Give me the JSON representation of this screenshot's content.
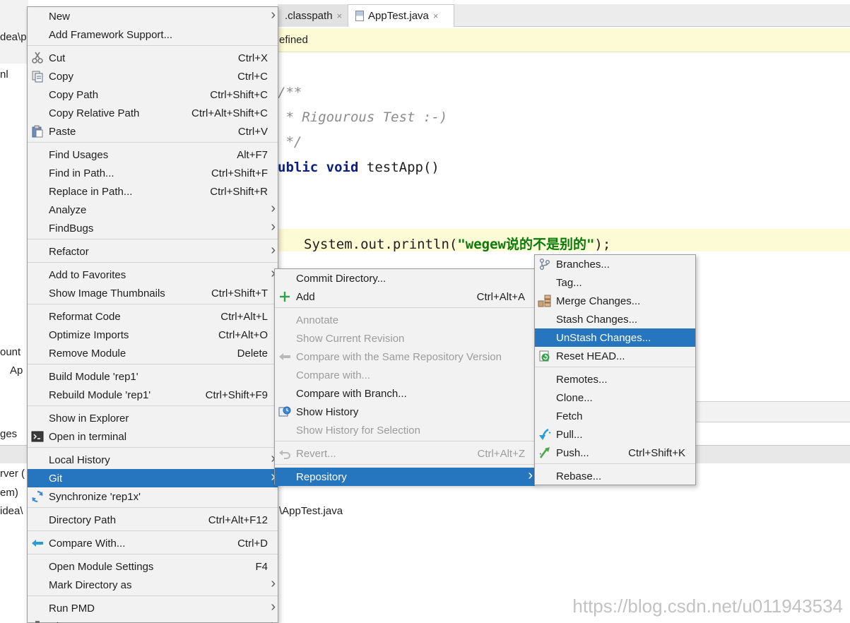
{
  "editor": {
    "tabs": [
      {
        "label": ".classpath"
      },
      {
        "label": "AppTest.java"
      }
    ],
    "tab_close_glyph": "×",
    "notification": "efined",
    "code_lines": [
      "/**",
      " * Rigourous Test :-)",
      " */",
      "ublic",
      "void",
      "testApp()",
      "System.out.println(",
      "\"wegew说的不是别的\"",
      ");"
    ],
    "bottom_path": "\\AppTest.java",
    "left_fragments": [
      "dea\\p",
      "nl",
      "ount",
      "Ap",
      "ges",
      "rver (",
      "em)",
      "idea\\"
    ]
  },
  "watermark": "https://blog.csdn.net/u011943534",
  "menu_main": [
    {
      "label": "New",
      "shortcut": "",
      "arrow": true,
      "icon": ""
    },
    {
      "label": "Add Framework Support...",
      "shortcut": "",
      "arrow": false,
      "icon": ""
    },
    {
      "sep": true
    },
    {
      "label": "Cut",
      "shortcut": "Ctrl+X",
      "arrow": false,
      "icon": "scissors-icon"
    },
    {
      "label": "Copy",
      "shortcut": "Ctrl+C",
      "arrow": false,
      "icon": "copy-icon"
    },
    {
      "label": "Copy Path",
      "shortcut": "Ctrl+Shift+C",
      "arrow": false,
      "icon": ""
    },
    {
      "label": "Copy Relative Path",
      "shortcut": "Ctrl+Alt+Shift+C",
      "arrow": false,
      "icon": ""
    },
    {
      "label": "Paste",
      "shortcut": "Ctrl+V",
      "arrow": false,
      "icon": "paste-icon"
    },
    {
      "sep": true
    },
    {
      "label": "Find Usages",
      "shortcut": "Alt+F7",
      "arrow": false,
      "icon": ""
    },
    {
      "label": "Find in Path...",
      "shortcut": "Ctrl+Shift+F",
      "arrow": false,
      "icon": ""
    },
    {
      "label": "Replace in Path...",
      "shortcut": "Ctrl+Shift+R",
      "arrow": false,
      "icon": ""
    },
    {
      "label": "Analyze",
      "shortcut": "",
      "arrow": true,
      "icon": ""
    },
    {
      "label": "FindBugs",
      "shortcut": "",
      "arrow": true,
      "icon": ""
    },
    {
      "sep": true
    },
    {
      "label": "Refactor",
      "shortcut": "",
      "arrow": true,
      "icon": ""
    },
    {
      "sep": true
    },
    {
      "label": "Add to Favorites",
      "shortcut": "",
      "arrow": true,
      "icon": ""
    },
    {
      "label": "Show Image Thumbnails",
      "shortcut": "Ctrl+Shift+T",
      "arrow": false,
      "icon": ""
    },
    {
      "sep": true
    },
    {
      "label": "Reformat Code",
      "shortcut": "Ctrl+Alt+L",
      "arrow": false,
      "icon": ""
    },
    {
      "label": "Optimize Imports",
      "shortcut": "Ctrl+Alt+O",
      "arrow": false,
      "icon": ""
    },
    {
      "label": "Remove Module",
      "shortcut": "Delete",
      "arrow": false,
      "icon": ""
    },
    {
      "sep": true
    },
    {
      "label": "Build Module 'rep1'",
      "shortcut": "",
      "arrow": false,
      "icon": ""
    },
    {
      "label": "Rebuild Module 'rep1'",
      "shortcut": "Ctrl+Shift+F9",
      "arrow": false,
      "icon": ""
    },
    {
      "sep": true
    },
    {
      "label": "Show in Explorer",
      "shortcut": "",
      "arrow": false,
      "icon": ""
    },
    {
      "label": "Open in terminal",
      "shortcut": "",
      "arrow": false,
      "icon": "terminal-icon"
    },
    {
      "sep": true
    },
    {
      "label": "Local History",
      "shortcut": "",
      "arrow": true,
      "icon": ""
    },
    {
      "label": "Git",
      "shortcut": "",
      "arrow": true,
      "icon": "",
      "selected": true
    },
    {
      "label": "Synchronize 'rep1x'",
      "shortcut": "",
      "arrow": false,
      "icon": "sync-icon"
    },
    {
      "sep": true
    },
    {
      "label": "Directory Path",
      "shortcut": "Ctrl+Alt+F12",
      "arrow": false,
      "icon": ""
    },
    {
      "sep": true
    },
    {
      "label": "Compare With...",
      "shortcut": "Ctrl+D",
      "arrow": false,
      "icon": "compare-icon"
    },
    {
      "sep": true
    },
    {
      "label": "Open Module Settings",
      "shortcut": "F4",
      "arrow": false,
      "icon": ""
    },
    {
      "label": "Mark Directory as",
      "shortcut": "",
      "arrow": true,
      "icon": ""
    },
    {
      "sep": true
    },
    {
      "label": "Run PMD",
      "shortcut": "",
      "arrow": true,
      "icon": ""
    },
    {
      "label": "Diagrams",
      "shortcut": "",
      "arrow": true,
      "icon": "diagram-icon"
    }
  ],
  "menu_git": [
    {
      "label": "Commit Directory...",
      "shortcut": "",
      "arrow": false,
      "icon": ""
    },
    {
      "label": "Add",
      "shortcut": "Ctrl+Alt+A",
      "arrow": false,
      "icon": "plus-icon"
    },
    {
      "sep": true
    },
    {
      "label": "Annotate",
      "shortcut": "",
      "arrow": false,
      "icon": "",
      "disabled": true
    },
    {
      "label": "Show Current Revision",
      "shortcut": "",
      "arrow": false,
      "icon": "",
      "disabled": true
    },
    {
      "label": "Compare with the Same Repository Version",
      "shortcut": "",
      "arrow": false,
      "icon": "compare-gray-icon",
      "disabled": true
    },
    {
      "label": "Compare with...",
      "shortcut": "",
      "arrow": false,
      "icon": "",
      "disabled": true
    },
    {
      "label": "Compare with Branch...",
      "shortcut": "",
      "arrow": false,
      "icon": ""
    },
    {
      "label": "Show History",
      "shortcut": "",
      "arrow": false,
      "icon": "history-icon"
    },
    {
      "label": "Show History for Selection",
      "shortcut": "",
      "arrow": false,
      "icon": "",
      "disabled": true
    },
    {
      "sep": true
    },
    {
      "label": "Revert...",
      "shortcut": "Ctrl+Alt+Z",
      "arrow": false,
      "icon": "revert-icon",
      "disabled": true
    },
    {
      "sep": true
    },
    {
      "label": "Repository",
      "shortcut": "",
      "arrow": true,
      "icon": "",
      "selected": true
    }
  ],
  "menu_repo": [
    {
      "label": "Branches...",
      "shortcut": "",
      "arrow": false,
      "icon": "branch-icon"
    },
    {
      "label": "Tag...",
      "shortcut": "",
      "arrow": false,
      "icon": ""
    },
    {
      "label": "Merge Changes...",
      "shortcut": "",
      "arrow": false,
      "icon": "merge-icon"
    },
    {
      "label": "Stash Changes...",
      "shortcut": "",
      "arrow": false,
      "icon": ""
    },
    {
      "label": "UnStash Changes...",
      "shortcut": "",
      "arrow": false,
      "icon": "",
      "selected": true
    },
    {
      "label": "Reset HEAD...",
      "shortcut": "",
      "arrow": false,
      "icon": "reset-icon"
    },
    {
      "sep": true
    },
    {
      "label": "Remotes...",
      "shortcut": "",
      "arrow": false,
      "icon": ""
    },
    {
      "label": "Clone...",
      "shortcut": "",
      "arrow": false,
      "icon": ""
    },
    {
      "label": "Fetch",
      "shortcut": "",
      "arrow": false,
      "icon": ""
    },
    {
      "label": "Pull...",
      "shortcut": "",
      "arrow": false,
      "icon": "pull-icon"
    },
    {
      "label": "Push...",
      "shortcut": "Ctrl+Shift+K",
      "arrow": false,
      "icon": "push-icon"
    },
    {
      "sep": true
    },
    {
      "label": "Rebase...",
      "shortcut": "",
      "arrow": false,
      "icon": ""
    }
  ]
}
